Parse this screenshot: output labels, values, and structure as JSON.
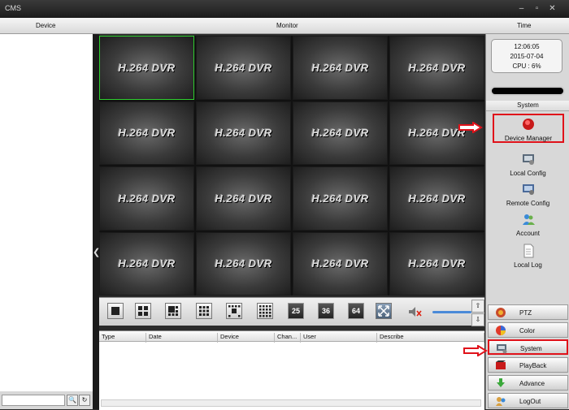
{
  "window": {
    "title": "CMS"
  },
  "header": {
    "device": "Device",
    "monitor": "Monitor",
    "time": "Time"
  },
  "video_tiles": [
    "H.264 DVR",
    "H.264 DVR",
    "H.264 DVR",
    "H.264 DVR",
    "H.264 DVR",
    "H.264 DVR",
    "H.264 DVR",
    "H.264 DVR",
    "H.264 DVR",
    "H.264 DVR",
    "H.264 DVR",
    "H.264 DVR",
    "H.264 DVR",
    "H.264 DVR",
    "H.264 DVR",
    "H.264 DVR"
  ],
  "toolbar": {
    "layout_25": "25",
    "layout_36": "36",
    "layout_64": "64"
  },
  "log": {
    "columns": [
      "Type",
      "Date",
      "Device",
      "Chan...",
      "User",
      "Describe"
    ]
  },
  "status": {
    "time": "12:06:05",
    "date": "2015-07-04",
    "cpu": "CPU : 6%"
  },
  "system_menu": {
    "title": "System",
    "items": [
      {
        "label": "Device Manager",
        "icon": "device-manager-icon"
      },
      {
        "label": "Local Config",
        "icon": "local-config-icon"
      },
      {
        "label": "Remote Config",
        "icon": "remote-config-icon"
      },
      {
        "label": "Account",
        "icon": "account-icon"
      },
      {
        "label": "Local Log",
        "icon": "local-log-icon"
      }
    ]
  },
  "nav": [
    {
      "label": "PTZ",
      "icon": "ptz-icon"
    },
    {
      "label": "Color",
      "icon": "color-icon"
    },
    {
      "label": "System",
      "icon": "system-icon"
    },
    {
      "label": "PlayBack",
      "icon": "playback-icon"
    },
    {
      "label": "Advance",
      "icon": "advance-icon"
    },
    {
      "label": "LogOut",
      "icon": "logout-icon"
    }
  ],
  "colors": {
    "highlight": "#e0121a",
    "selected_tile": "#2fcf2f",
    "accent": "#4a8ad8"
  }
}
